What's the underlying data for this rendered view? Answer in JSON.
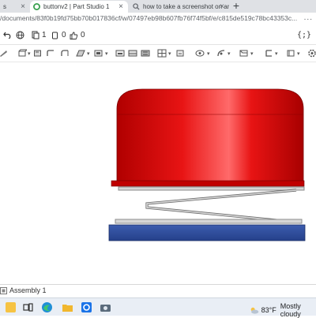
{
  "browser": {
    "tabs": [
      {
        "label": "s"
      },
      {
        "label": "buttonv2 | Part Studio 1"
      },
      {
        "label": "how to take a screenshot on an"
      }
    ],
    "new_tab_label": "+",
    "url": "/documents/83f0b19fd75bb70b017836cf/w/07497eb98b607fb76f74f5bf/e/c815de519c78bc43353c...",
    "menu_label": "..."
  },
  "header": {
    "follow_count": "1",
    "comment_count": "0",
    "like_count": "0",
    "code_label": "{;}"
  },
  "bottom_tab": {
    "label": "Assembly 1"
  },
  "taskbar": {
    "temperature": "83°F",
    "condition": "Mostly cloudy"
  },
  "colors": {
    "button_cap": "#e01010",
    "spring": "#c7c7c7",
    "base": "#2c4a9a",
    "onshape_green": "#3aa150"
  }
}
